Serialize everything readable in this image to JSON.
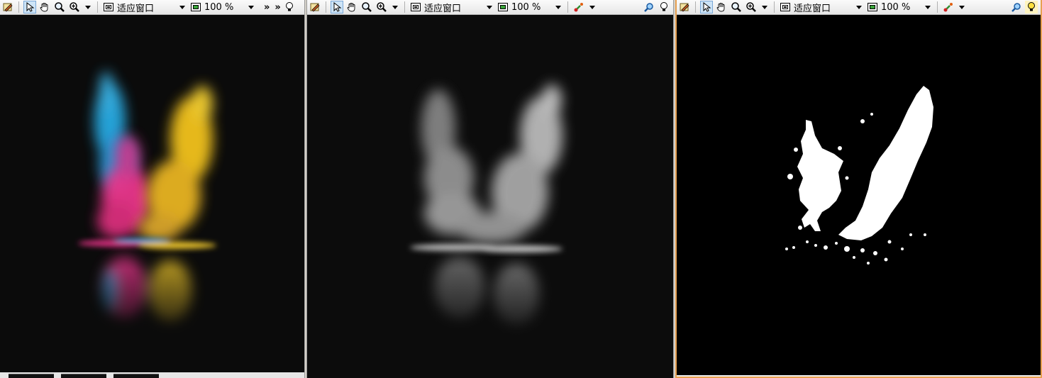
{
  "toolbar": {
    "fit_label": "适应窗口",
    "zoom_label": "100 %",
    "overflow_label": "»"
  },
  "panes": [
    {
      "name": "color-image",
      "view": "rgb"
    },
    {
      "name": "grayscale-image",
      "view": "gray"
    },
    {
      "name": "binary-mask",
      "view": "binary"
    }
  ],
  "colors": {
    "accent_border": "#e8a050",
    "cyan": "#27a9e1",
    "magenta": "#e8348a",
    "yellow": "#f2c21b"
  },
  "icons": [
    "edit-icon",
    "pointer-icon",
    "hand-pan-icon",
    "zoom-icon",
    "zoom-plus-icon",
    "fit-window-icon",
    "zoom-percent-icon",
    "color-picker-icon",
    "search-icon",
    "lightbulb-icon"
  ]
}
